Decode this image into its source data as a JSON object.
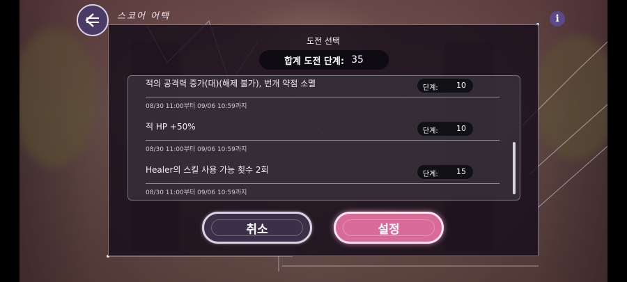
{
  "header": {
    "title": "스코어 어택"
  },
  "dialog": {
    "title": "도전 선택",
    "total_label": "합계 도전 단계:",
    "total_value": "35"
  },
  "challenges": [
    {
      "name": "적의 공격력 증가(대)(해제 불가), 번개 약점 소멸",
      "level_label": "단계:",
      "level": "10",
      "period": "08/30 11:00부터 09/06 10:59까지"
    },
    {
      "name": "적 HP +50%",
      "level_label": "단계:",
      "level": "10",
      "period": "08/30 11:00부터 09/06 10:59까지"
    },
    {
      "name": "Healer의 스킬 사용 가능 횟수 2회",
      "level_label": "단계:",
      "level": "15",
      "period": "08/30 11:00부터 09/06 10:59까지"
    }
  ],
  "buttons": {
    "cancel": "취소",
    "confirm": "설정"
  },
  "icons": {
    "back": "back-arrow-icon",
    "info": "info-icon"
  },
  "colors": {
    "confirm": "#d96b9a",
    "cancel": "#3c3049",
    "panel": "#160e1a"
  }
}
